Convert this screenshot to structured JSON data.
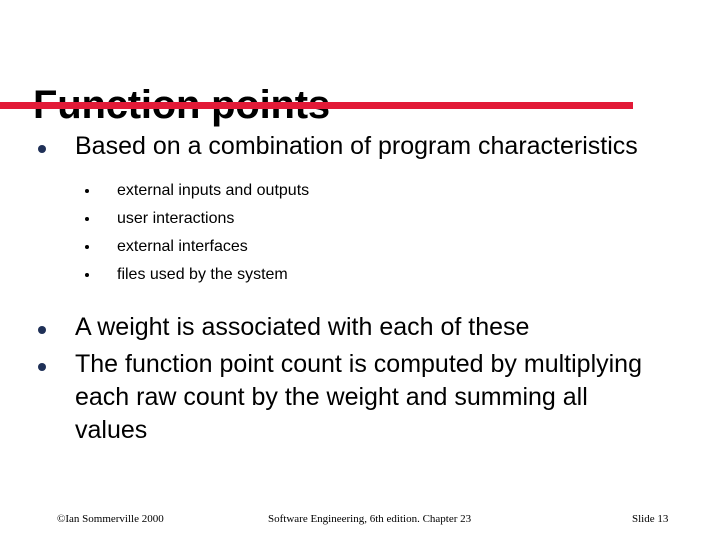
{
  "slide": {
    "title": "Function points",
    "accent_color": "#E21A37",
    "bullet_color": "#1F3057",
    "background_color": "#FFFFFF",
    "body": {
      "bullets": [
        {
          "text": "Based on a combination of program characteristics",
          "sub_bullets": [
            "external inputs and outputs",
            "user interactions",
            "external interfaces",
            "files used by the system"
          ]
        },
        {
          "text": "A weight is associated with each of these",
          "sub_bullets": []
        },
        {
          "text": "The function point count is computed by multiplying each raw count by the weight and summing all values",
          "sub_bullets": []
        }
      ]
    },
    "footer": {
      "left": "©Ian Sommerville 2000",
      "center": "Software Engineering, 6th edition. Chapter 23",
      "right": "Slide 13"
    }
  }
}
